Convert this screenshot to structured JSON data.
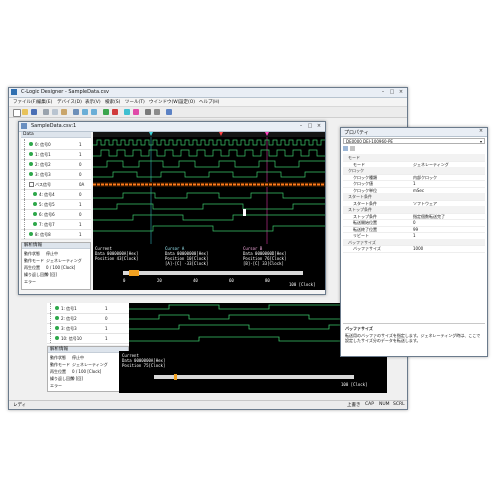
{
  "main_window": {
    "title": "C-Logic Designer - SampleData.csv",
    "menu": [
      "ファイル(F)",
      "編集(E)",
      "デバイス(D)",
      "表示(V)",
      "検索(S)",
      "ツール(T)",
      "ウインドウ(W)",
      "設定(O)",
      "ヘルプ(H)"
    ],
    "status_left": "レディ",
    "status_right": [
      "上書き",
      "CAP",
      "NUM",
      "SCRL"
    ]
  },
  "lower_signals": [
    {
      "name": "1: 信号1",
      "value": "1"
    },
    {
      "name": "2: 信号2",
      "value": "0"
    },
    {
      "name": "3: 信号3",
      "value": "1"
    },
    {
      "name": "10: 信号10",
      "value": "1"
    }
  ],
  "lower_info": {
    "header": "解析情報",
    "rows": [
      {
        "label": "動作状態",
        "value": "停止中"
      },
      {
        "label": "動作モード",
        "value": "ジェネレーティング"
      },
      {
        "label": "再生位置",
        "value": "0 / 100 [Clock]"
      },
      {
        "label": "繰り返し回数",
        "value": "0 [回]"
      },
      {
        "label": "エラー",
        "value": ""
      }
    ]
  },
  "lower_cursor": {
    "lines": [
      "Current",
      "Data  0000000A[Hex]",
      "Position 75[Clock]"
    ],
    "scale_end": "100 [Clock]"
  },
  "child_window": {
    "title": "SampleData.csv:1",
    "list_header": "Data",
    "signals": [
      {
        "name": "0: 信号0",
        "value": "1"
      },
      {
        "name": "1: 信号1",
        "value": "1"
      },
      {
        "name": "2: 信号2",
        "value": "0"
      },
      {
        "name": "3: 信号3",
        "value": "0"
      },
      {
        "name": "バス信号",
        "value": "0A"
      },
      {
        "name": "4: 信号4",
        "value": "0"
      },
      {
        "name": "5: 信号5",
        "value": "1"
      },
      {
        "name": "6: 信号6",
        "value": "0"
      },
      {
        "name": "7: 信号7",
        "value": "1"
      },
      {
        "name": "8: 信号8",
        "value": "1"
      }
    ],
    "info": {
      "header": "解析情報",
      "rows": [
        {
          "label": "動作状態",
          "value": "停止中"
        },
        {
          "label": "動作モード",
          "value": "ジェネレーティング"
        },
        {
          "label": "再生位置",
          "value": "0 / 100 [Clock]"
        },
        {
          "label": "繰り返し回数",
          "value": "0 [回]"
        },
        {
          "label": "エラー",
          "value": ""
        }
      ]
    },
    "cursor_cols": [
      {
        "lines": [
          "Current",
          "Data 0000000A[Hex]",
          "Position 43[Clock]"
        ]
      },
      {
        "lines": [
          "Cursor A",
          "Data  00000000[Hex]",
          "Position 10[Clock]",
          "[A]-[C]  -33[Clock]"
        ]
      },
      {
        "lines": [
          "Cursor B",
          "Data  0000000D[Hex]",
          "Position 76[Clock]",
          "[B]-[C]  33[Clock]"
        ]
      }
    ],
    "scale_labels": [
      "0",
      "20",
      "40",
      "60",
      "80",
      "100 [Clock]"
    ]
  },
  "properties": {
    "title": "プロパティ",
    "device": "DE0000 DEI-100960-PE",
    "sections": [
      {
        "category": "モード",
        "rows": [
          {
            "k": "モード",
            "v": "ジェネレーティング"
          }
        ]
      },
      {
        "category": "クロック",
        "rows": [
          {
            "k": "クロック種類",
            "v": "内部クロック"
          },
          {
            "k": "クロック値",
            "v": "1"
          },
          {
            "k": "クロック単位",
            "v": "mSec"
          }
        ]
      },
      {
        "category": "スタート条件",
        "rows": [
          {
            "k": "スタート条件",
            "v": "ソフトウェア"
          }
        ]
      },
      {
        "category": "ストップ条件",
        "rows": [
          {
            "k": "ストップ条件",
            "v": "指定個数転送完了"
          },
          {
            "k": "転送開始位置",
            "v": "0"
          },
          {
            "k": "転送終了位置",
            "v": "99"
          },
          {
            "k": "リピート",
            "v": "1"
          }
        ]
      },
      {
        "category": "バッファサイズ",
        "rows": [
          {
            "k": "バッファサイズ",
            "v": "1000"
          }
        ]
      }
    ],
    "desc_title": "バッファサイズ",
    "desc_text": "転送用のバッファのサイズを指定します。ジェネレーティング時は、ここで設定したサイズ分のデータを転送します。"
  },
  "colors": {
    "accent": "#2f6fb0",
    "waveform": "#3cc86b",
    "bus": "#ff7a1a",
    "marker_a": "#39d0d8",
    "marker_b": "#ff40c0"
  }
}
